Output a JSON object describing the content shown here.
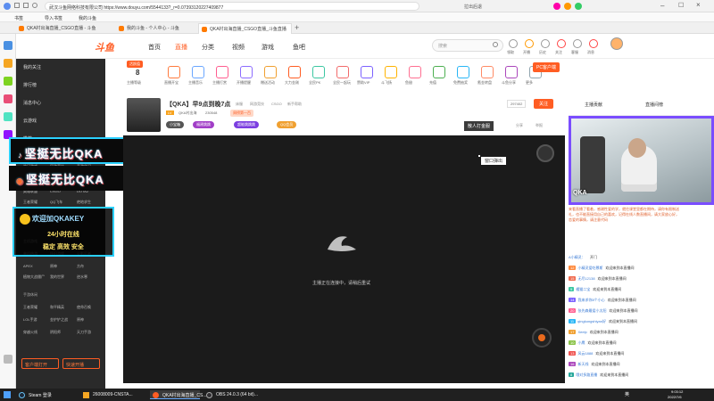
{
  "browser": {
    "address": "武汉斗鱼网络科技有限公司 https://www.douyu.com/5544133?_r=0.07393120227409877",
    "bookmarks": [
      "书签",
      "导入书签",
      "我的斗鱼"
    ],
    "tabs": [
      "QKA村出海直播_CSGO直播 - 斗鱼",
      "我的斗鱼 - 个人中心 - 斗鱼",
      "QKA村出海直播_CSGO直播_斗鱼直播"
    ],
    "top_right": "拉出后退"
  },
  "header": {
    "logo": "斗鱼",
    "nav": [
      "首页",
      "直播",
      "分类",
      "视频",
      "游戏",
      "鱼吧"
    ],
    "search_placeholder": "搜索",
    "icons": [
      "领取",
      "开播",
      "历史",
      "关注",
      "客服",
      "消息",
      "个人中心"
    ],
    "pc_button": "PC客户端"
  },
  "sidebar": {
    "items": [
      "我的关注",
      "排行榜",
      "消息中心",
      "云游戏",
      "推荐"
    ],
    "categories": [
      "热门游戏",
      "网游竞技",
      "手游休闲",
      "英雄联盟",
      "王者荣耀",
      "CSGO",
      "绝地求生",
      "DOTA2",
      "QQ飞车",
      "主机游戏",
      "单机热游",
      "怀旧游戏",
      "火影忍者",
      "原神",
      "APEX",
      "植物大战僵尸",
      "我的世界",
      "方舟",
      "LOL",
      "逆水寒",
      "魔兽世界",
      "王者荣耀",
      "和平精英",
      "LOL手游",
      "金铲铲之战",
      "使命召唤",
      "原神",
      "宝可梦",
      "穿越火线",
      "决战平安京",
      "阴阳师",
      "暗黑",
      "天刀手游"
    ],
    "section_headers": [
      "主机游戏",
      "手游休闲"
    ],
    "bottom_buttons": [
      "客户端打开",
      "快速开播"
    ]
  },
  "overlay": {
    "banner1": "坚挺无比QKA",
    "banner2": "坚挺无比QKA",
    "wechat_line1": "欢迎加QKAKEY",
    "wechat_line2": "24小时在线",
    "wechat_line3": "稳定 高效 安全"
  },
  "gift_bar": {
    "badge": "活跃值",
    "level": "8",
    "level_label": "主播等级",
    "items": [
      "直播开宝",
      "主播音乐",
      "主播打赏",
      "开播提醒",
      "赠送活动",
      "大力金刚",
      "全民PK",
      "全民一起玩",
      "赞助VIP",
      "斗飞扬",
      "鱼翅",
      "充值",
      "免费抽奖",
      "氪金转盘",
      "斗鱼分享",
      "更多"
    ]
  },
  "room": {
    "title": "【QKA】早9点到晚7点",
    "tags": [
      "床服",
      "网游竞技",
      "CSGO",
      "新手帮助"
    ],
    "streamer": "QKA村出海",
    "fans": "230548",
    "rank": "周榜第一百",
    "chips": [
      "小宝箱",
      "福建跳跳",
      "超能跳跳跳",
      "QQ会员"
    ],
    "follow_count": "297402",
    "follow_label": "关注",
    "share": "分享",
    "report": "举报",
    "action": "散人打金服",
    "popout": "窗口弹出"
  },
  "video": {
    "status": "主播正在连接中，请稍后重试"
  },
  "chat": {
    "tabs": [
      "主播贡献",
      "直播间榜"
    ],
    "notice": "来看直播了看着，感谢性爱的学，就往课堂里都在期待，请你有限制送礼，也不能直接用自己的喜欢，记得在线人数直播间，请大家放心好，恋爱的事情，请注意代码",
    "anchor_line": "A小精灵：",
    "anchor_text": "开门",
    "messages": [
      {
        "level": "12",
        "name": "小精灵爱吃慕斯",
        "text": "欢迎来到本直播间"
      },
      {
        "level": "15",
        "name": "无尽12138",
        "text": "欢迎来到本直播间"
      },
      {
        "level": "9",
        "name": "橘猫二宝",
        "text": "欢迎来到本直播间"
      },
      {
        "level": "14",
        "name": "我来求你8个小心",
        "text": "欢迎来到本直播间"
      },
      {
        "level": "20",
        "name": "张先森最爱小太阳",
        "text": "欢迎来到本直播间"
      },
      {
        "level": "11",
        "name": "qingkongshiyan好",
        "text": "欢迎来到本直播间"
      },
      {
        "level": "17",
        "name": "Xeelp",
        "text": "欢迎来到本直播间"
      },
      {
        "level": "10",
        "name": "小鹰",
        "text": "欢迎来到本直播间"
      },
      {
        "level": "13",
        "name": "风云1888",
        "text": "欢迎来到本直播间"
      },
      {
        "level": "16",
        "name": "新天线",
        "text": "欢迎来到本直播间"
      },
      {
        "level": "8",
        "name": "哦对多路直播",
        "text": "欢迎来到本直播间"
      }
    ]
  },
  "cam": {
    "watermark": "QKA"
  },
  "taskbar": {
    "items": [
      "Steam 登录",
      "26008009-CNSTA...",
      "QKA村出海直播_CS...",
      "OBS 24.0.3 (64 bit)..."
    ],
    "time": "9:03:12",
    "date": "2022/7/6",
    "lang": "英"
  },
  "colors": {
    "accent": "#ff5d23",
    "cam_border": "#7a4dff",
    "taskbar": "#202020"
  }
}
